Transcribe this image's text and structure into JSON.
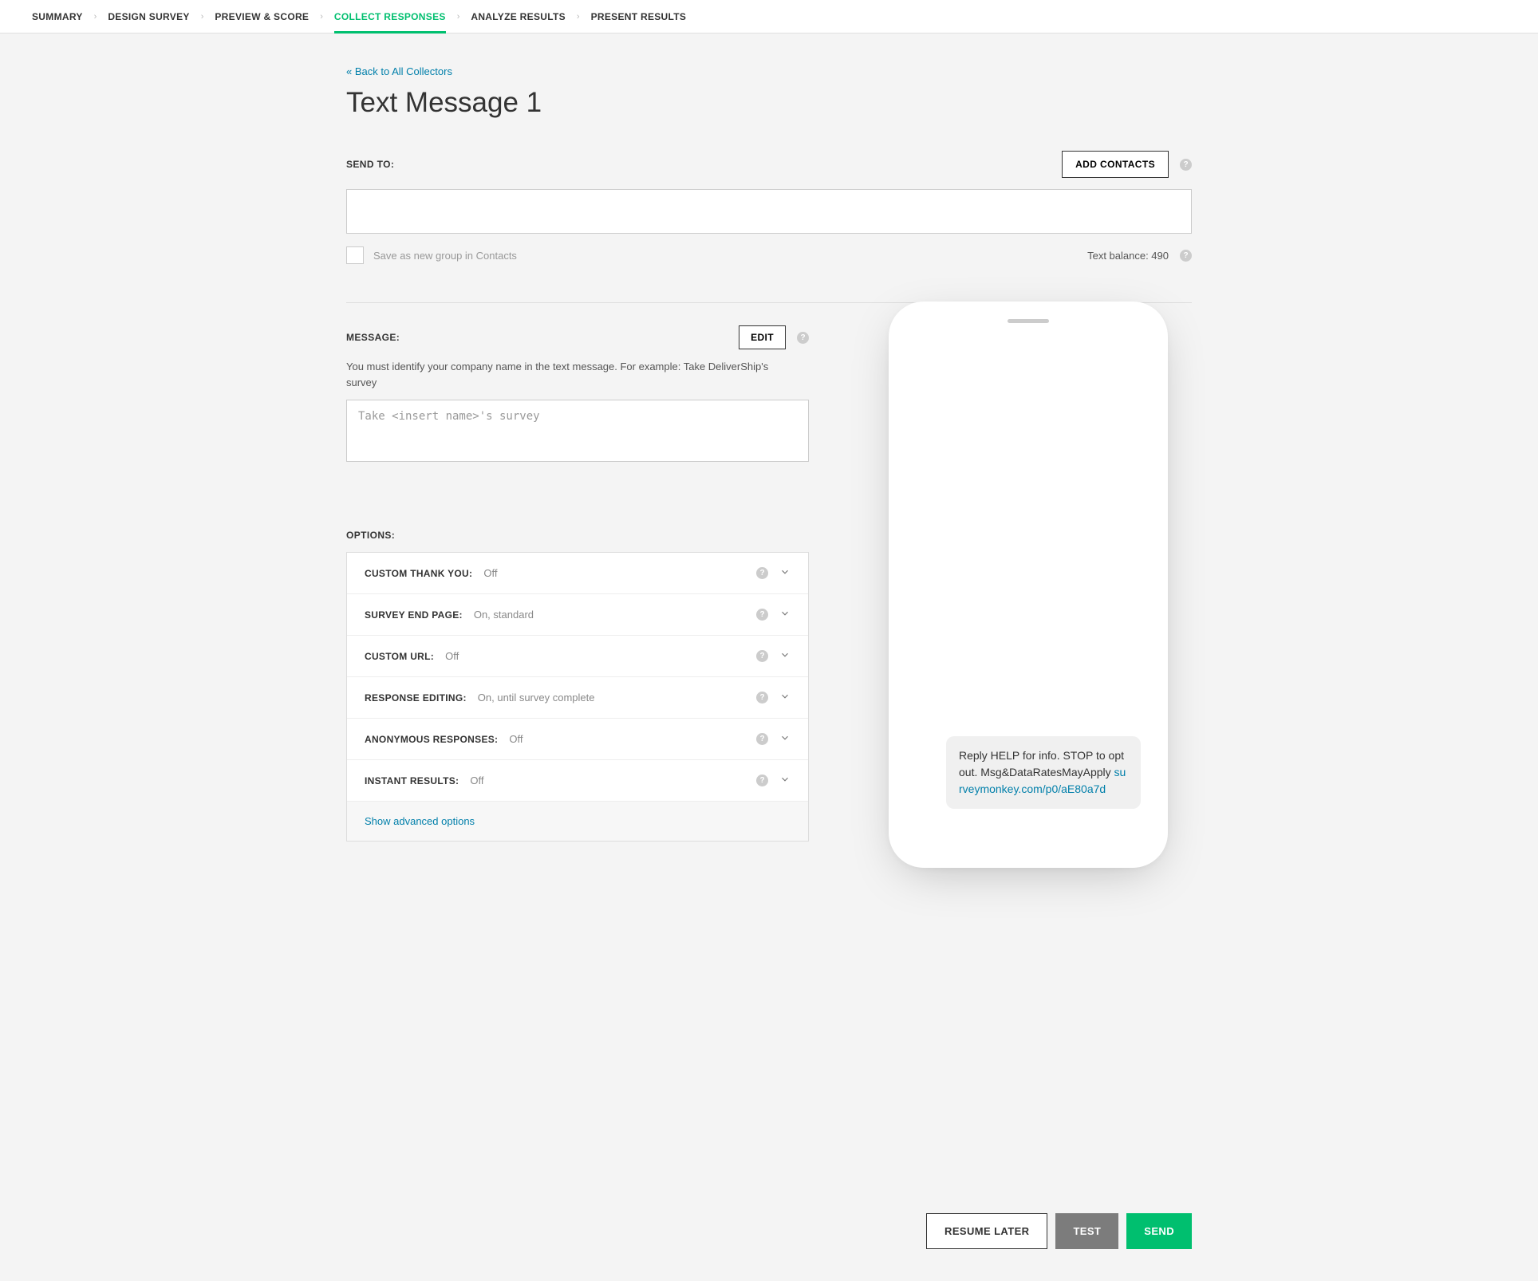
{
  "nav": {
    "items": [
      "SUMMARY",
      "DESIGN SURVEY",
      "PREVIEW & SCORE",
      "COLLECT RESPONSES",
      "ANALYZE RESULTS",
      "PRESENT RESULTS"
    ],
    "active_index": 3
  },
  "back_link": "« Back to All Collectors",
  "page_title": "Text Message 1",
  "send_to": {
    "label": "SEND TO:",
    "add_contacts_btn": "ADD CONTACTS",
    "input_value": "",
    "save_group_label": "Save as new group in Contacts",
    "text_balance_label": "Text balance: 490"
  },
  "message": {
    "label": "MESSAGE:",
    "edit_btn": "EDIT",
    "help_text": "You must identify your company name in the text message. For example: Take DeliverShip's survey",
    "placeholder": "Take <insert name>'s survey"
  },
  "options_label": "OPTIONS:",
  "options": [
    {
      "label": "CUSTOM THANK YOU:",
      "value": "Off"
    },
    {
      "label": "SURVEY END PAGE:",
      "value": "On, standard"
    },
    {
      "label": "CUSTOM URL:",
      "value": "Off"
    },
    {
      "label": "RESPONSE EDITING:",
      "value": "On, until survey complete"
    },
    {
      "label": "ANONYMOUS RESPONSES:",
      "value": "Off"
    },
    {
      "label": "INSTANT RESULTS:",
      "value": "Off"
    }
  ],
  "show_advanced": "Show advanced options",
  "phone": {
    "sms_text_prefix": "Reply HELP for info. STOP to opt out. Msg&DataRatesMayApply ",
    "sms_link": "surveymonkey.com/p0/aE80a7d"
  },
  "footer": {
    "resume": "RESUME LATER",
    "test": "TEST",
    "send": "SEND"
  }
}
